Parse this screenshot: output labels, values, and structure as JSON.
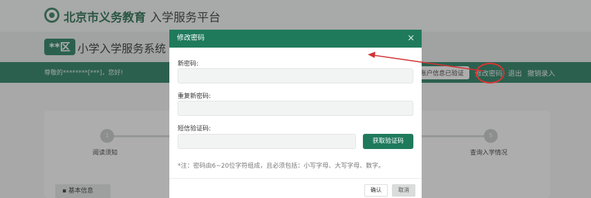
{
  "header": {
    "brand_title": "北京市义务教育",
    "brand_subtitle": "入学服务平台",
    "area_badge": "**区",
    "system_title": "小学入学服务系统"
  },
  "nav": {
    "greeting": "尊敬的********[***]，您好!",
    "account_verified": "账户信息已验证",
    "change_password": "修改密码",
    "logout": "退出",
    "cancel_entry": "撤销录入"
  },
  "steps": [
    {
      "number": "1",
      "label": "阅读须知"
    },
    {
      "number": "5",
      "label": "查询入学情况"
    }
  ],
  "info_tab": "基本信息",
  "modal": {
    "title": "修改密码",
    "close_icon": "close-icon",
    "new_password_label": "新密码:",
    "new_password_value": "",
    "repeat_password_label": "重复新密码:",
    "repeat_password_value": "",
    "sms_code_label": "短信验证码:",
    "sms_code_value": "",
    "get_code_button": "获取验证码",
    "note": "*注：密码由6~20位字符组成，且必须包括：小写字母、大写字母、数字。",
    "confirm_button": "确认",
    "cancel_button": "取消"
  },
  "colors": {
    "primary": "#1f7a5c",
    "annotation": "#d33333"
  }
}
